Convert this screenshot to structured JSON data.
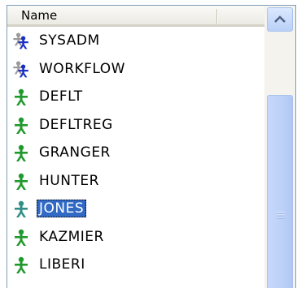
{
  "header": {
    "name_label": "Name"
  },
  "rows": [
    {
      "label": "SYSADM",
      "icon": "user-blue-grey-icon",
      "selected": false
    },
    {
      "label": "WORKFLOW",
      "icon": "user-blue-grey-icon",
      "selected": false
    },
    {
      "label": "DEFLT",
      "icon": "user-green-icon",
      "selected": false
    },
    {
      "label": "DEFLTREG",
      "icon": "user-green-icon",
      "selected": false
    },
    {
      "label": "GRANGER",
      "icon": "user-green-icon",
      "selected": false
    },
    {
      "label": "HUNTER",
      "icon": "user-green-icon",
      "selected": false
    },
    {
      "label": "JONES",
      "icon": "user-teal-icon",
      "selected": true
    },
    {
      "label": "KAZMIER",
      "icon": "user-green-icon",
      "selected": false
    },
    {
      "label": "LIBERI",
      "icon": "user-green-icon",
      "selected": false
    }
  ],
  "colors": {
    "selection": "#316ac5",
    "user_green": "#1f9a2c",
    "user_blue": "#1a2fc2",
    "user_grey": "#9a9a9a",
    "user_teal": "#2f8f86"
  }
}
